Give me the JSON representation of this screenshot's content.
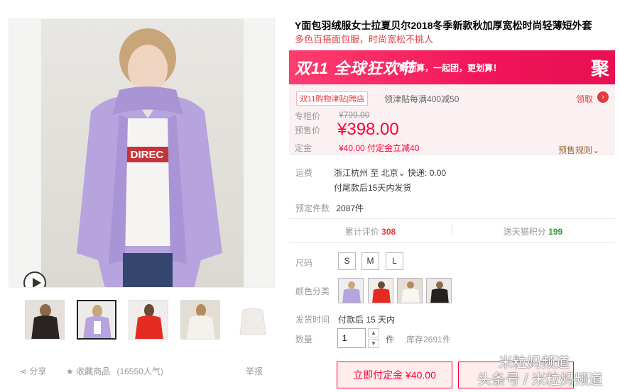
{
  "product": {
    "title": "Y面包羽绒服女士拉夏贝尔2018冬季新款秋加厚宽松时尚轻薄短外套",
    "subtitle": "多色百搭面包服，时尚宽松不挑人"
  },
  "promo": {
    "big_text": "双11 全球狂欢节",
    "slogan": "聚划算，一起团，更划算！",
    "ju": "聚"
  },
  "coupon": {
    "tag": "双11购物津贴|跨店",
    "text": "领津贴每满400减50",
    "get_label": "领取",
    "arrow": "›"
  },
  "price": {
    "orig_label": "专柜价",
    "orig_value": "¥799.00",
    "sale_label": "预售价",
    "sale_value": "¥398.00",
    "deposit_label": "定金",
    "deposit_value": "¥40.00 付定金立减40",
    "rule_label": "预售规则⌄"
  },
  "shipping": {
    "label": "运费",
    "route": "浙江杭州 至 北京⌄ 快递: 0.00",
    "note": "付尾款后15天内发货"
  },
  "preorder": {
    "label": "预定件数",
    "value": "2087件"
  },
  "stats": {
    "reviews_label": "累计评价",
    "reviews_value": "308",
    "points_label": "送天猫积分",
    "points_value": "199"
  },
  "sku": {
    "size_label": "尺码",
    "sizes": [
      "S",
      "M",
      "L"
    ],
    "color_label": "颜色分类",
    "ship_label": "发货时间",
    "ship_value": "付款后 15 天内",
    "qty_label": "数量",
    "qty_value": "1",
    "qty_unit": "件",
    "stock": "库存2691件"
  },
  "buttons": {
    "deposit": "立即付定金 ¥40.00"
  },
  "actions": {
    "share": "分享",
    "favorite": "收藏商品",
    "fav_count": "(16550人气)",
    "report": "举报"
  },
  "watermark": {
    "line1": "米粒妈频道",
    "line2": "头条号 / 米粒妈频道"
  },
  "colors": {
    "accent": "#ff0036",
    "promo_pink": "#f2145a",
    "stat_red": "#e4393c",
    "stat_green": "#2c9d2c"
  }
}
